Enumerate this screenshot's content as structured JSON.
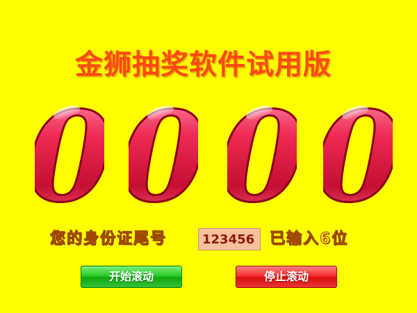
{
  "app": {
    "title": "金狮抽奖软件试用版"
  },
  "digits": [
    "0",
    "0",
    "0",
    "0"
  ],
  "id_entry": {
    "label": "您的身份证尾号",
    "value": "123456",
    "status": "已输入6位"
  },
  "buttons": {
    "start": "开始滚动",
    "stop": "停止滚动"
  },
  "colors": {
    "background": "#ffff00",
    "title": "#ff4a12",
    "digit": "#e3133a",
    "start_button": "#22c622",
    "stop_button": "#f02a2a"
  }
}
